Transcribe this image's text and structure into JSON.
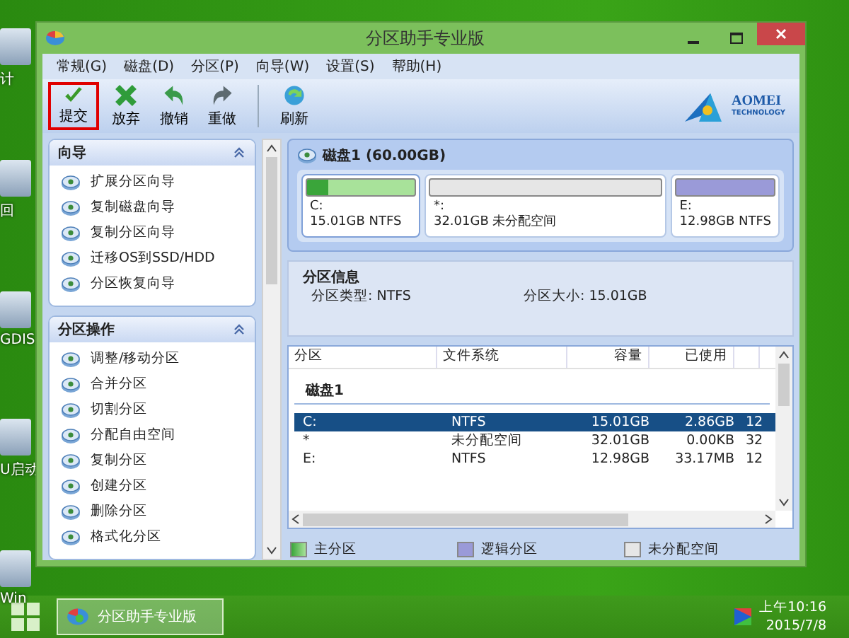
{
  "desktop_icons": [
    {
      "label": "计"
    },
    {
      "label": "回"
    },
    {
      "label": "GDIS"
    },
    {
      "label": "U启动"
    },
    {
      "label": "Win"
    }
  ],
  "window": {
    "title": "分区助手专业版"
  },
  "menu": [
    "常规(G)",
    "磁盘(D)",
    "分区(P)",
    "向导(W)",
    "设置(S)",
    "帮助(H)"
  ],
  "toolbar": [
    {
      "label": "提交",
      "kind": "apply",
      "highlighted": true
    },
    {
      "label": "放弃",
      "kind": "discard",
      "highlighted": false
    },
    {
      "label": "撤销",
      "kind": "undo",
      "highlighted": false
    },
    {
      "label": "重做",
      "kind": "redo",
      "highlighted": false
    },
    {
      "label": "刷新",
      "kind": "refresh",
      "highlighted": false
    }
  ],
  "logo": {
    "name": "AOMEI",
    "sub": "TECHNOLOGY"
  },
  "sidebar": [
    {
      "title": "向导",
      "expanded": true,
      "items": [
        "扩展分区向导",
        "复制磁盘向导",
        "复制分区向导",
        "迁移OS到SSD/HDD",
        "分区恢复向导"
      ]
    },
    {
      "title": "分区操作",
      "expanded": true,
      "items": [
        "调整/移动分区",
        "合并分区",
        "切割分区",
        "分配自由空间",
        "复制分区",
        "创建分区",
        "删除分区",
        "格式化分区"
      ]
    }
  ],
  "disk_map": {
    "title": "磁盘1 (60.00GB)",
    "partitions": [
      {
        "kind": "primary",
        "letter": "C:",
        "info": "15.01GB NTFS",
        "level": 0.2,
        "selected": true
      },
      {
        "kind": "unallocated",
        "letter": "*:",
        "info": "32.01GB 未分配空间",
        "selected": false
      },
      {
        "kind": "logical",
        "letter": "E:",
        "info": "12.98GB NTFS",
        "selected": false
      }
    ]
  },
  "partition_info": {
    "title": "分区信息",
    "type": "分区类型: NTFS",
    "size": "分区大小: 15.01GB"
  },
  "table": {
    "columns": [
      "分区",
      "文件系统",
      "容量",
      "已使用"
    ],
    "group": "磁盘1",
    "rows": [
      {
        "cells": [
          "C:",
          "NTFS",
          "15.01GB",
          "2.86GB",
          "12"
        ],
        "selected": true
      },
      {
        "cells": [
          "*",
          "未分配空间",
          "32.01GB",
          "0.00KB",
          "32"
        ],
        "selected": false
      },
      {
        "cells": [
          "E:",
          "NTFS",
          "12.98GB",
          "33.17MB",
          "12"
        ],
        "selected": false
      }
    ]
  },
  "legend": [
    {
      "kind": "primary",
      "label": "主分区"
    },
    {
      "kind": "logical",
      "label": "逻辑分区"
    },
    {
      "kind": "unallocated",
      "label": "未分配空间"
    }
  ],
  "taskbar": {
    "app": "分区助手专业版",
    "time": "上午10:16",
    "date": "2015/7/8"
  }
}
